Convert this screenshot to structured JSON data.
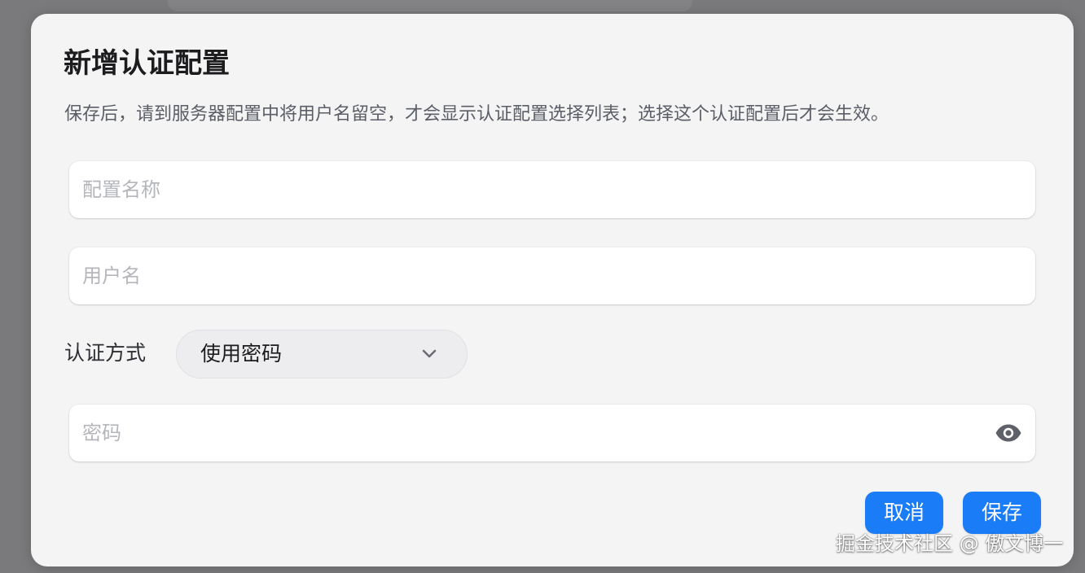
{
  "dialog": {
    "title": "新增认证配置",
    "description": "保存后，请到服务器配置中将用户名留空，才会显示认证配置选择列表；选择这个认证配置后才会生效。"
  },
  "fields": {
    "config_name": {
      "placeholder": "配置名称",
      "value": ""
    },
    "username": {
      "placeholder": "用户名",
      "value": ""
    },
    "password": {
      "placeholder": "密码",
      "value": "",
      "toggle_icon": "eye-icon"
    }
  },
  "auth_method": {
    "label": "认证方式",
    "selected": "使用密码",
    "icon": "chevron-down-icon"
  },
  "buttons": {
    "cancel": "取消",
    "save": "保存"
  },
  "watermark": "掘金技术社区 @ 傲文博一",
  "colors": {
    "accent": "#1a7cf7",
    "modal_bg": "#f4f4f5",
    "overlay": "#7a7a7c"
  }
}
